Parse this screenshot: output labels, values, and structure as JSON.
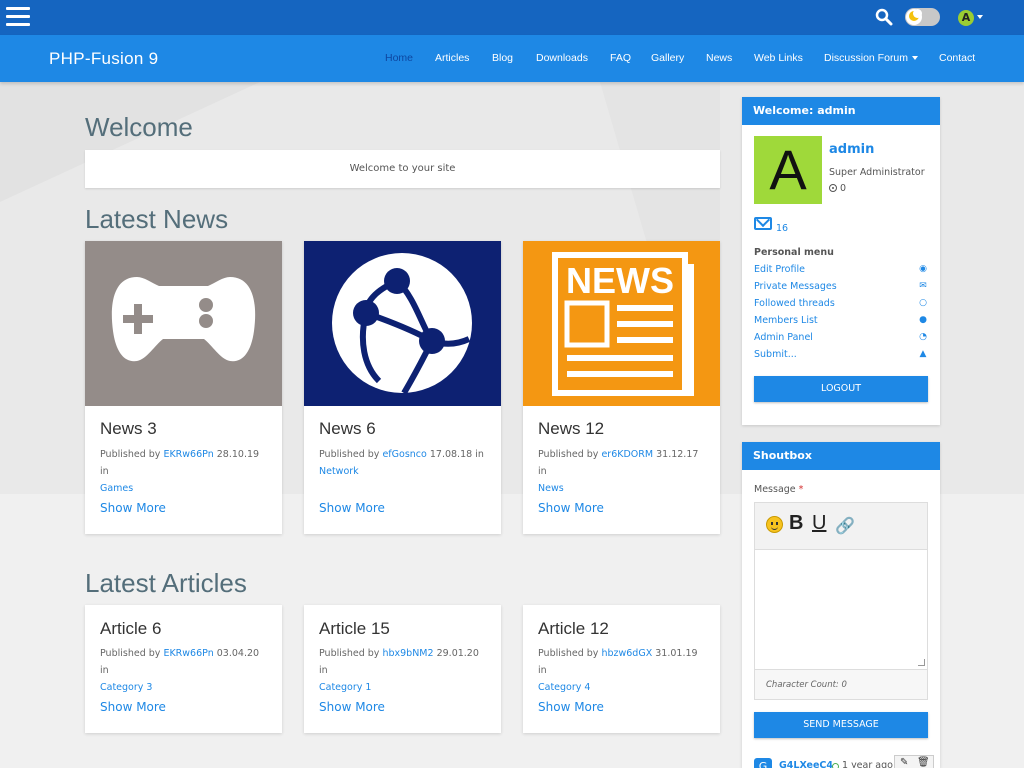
{
  "topbar": {
    "menu_icon": "hamburger-icon",
    "search_icon": "search-icon",
    "theme_icon": "moon-toggle-icon",
    "user_initial": "A"
  },
  "nav": {
    "brand": "PHP-Fusion 9",
    "items": [
      {
        "label": "Home",
        "active": true
      },
      {
        "label": "Articles"
      },
      {
        "label": "Blog"
      },
      {
        "label": "Downloads"
      },
      {
        "label": "FAQ"
      },
      {
        "label": "Gallery"
      },
      {
        "label": "News"
      },
      {
        "label": "Web Links"
      },
      {
        "label": "Discussion Forum",
        "dropdown": true
      },
      {
        "label": "Contact"
      }
    ]
  },
  "welcome": {
    "title": "Welcome",
    "message": "Welcome to your site"
  },
  "latest_news": {
    "title": "Latest News",
    "cards": [
      {
        "title": "News 3",
        "published_by": "Published by",
        "author": "EKRw66Pn",
        "date": "28.10.19",
        "in": "in",
        "category": "Games",
        "more": "Show More",
        "image_icon": "gamepad-icon",
        "image_color": "#948c89"
      },
      {
        "title": "News 6",
        "published_by": "Published by",
        "author": "efGosnco",
        "date": "17.08.18",
        "in": "in",
        "category": "Network",
        "more": "Show More",
        "image_icon": "globe-network-icon",
        "image_color": "#0d2172"
      },
      {
        "title": "News 12",
        "published_by": "Published by",
        "author": "er6KDORM",
        "date": "31.12.17",
        "in": "in",
        "category": "News",
        "more": "Show More",
        "image_icon": "newspaper-icon",
        "image_color": "#f49712"
      }
    ]
  },
  "latest_articles": {
    "title": "Latest Articles",
    "cards": [
      {
        "title": "Article 6",
        "published_by": "Published by",
        "author": "EKRw66Pn",
        "date": "03.04.20",
        "in": "in",
        "category": "Category 3",
        "more": "Show More"
      },
      {
        "title": "Article 15",
        "published_by": "Published by",
        "author": "hbx9bNM2",
        "date": "29.01.20",
        "in": "in",
        "category": "Category 1",
        "more": "Show More"
      },
      {
        "title": "Article 12",
        "published_by": "Published by",
        "author": "hbzw6dGX",
        "date": "31.01.19",
        "in": "in",
        "category": "Category 4",
        "more": "Show More"
      }
    ]
  },
  "user_panel": {
    "title": "Welcome: admin",
    "avatar_letter": "A",
    "username": "admin",
    "role": "Super Administrator",
    "reputation": "0",
    "messages_count": "16",
    "personal_menu_title": "Personal menu",
    "menu": [
      {
        "label": "Edit Profile",
        "icon": "user-circle-icon"
      },
      {
        "label": "Private Messages",
        "icon": "envelope-icon"
      },
      {
        "label": "Followed threads",
        "icon": "comment-icon"
      },
      {
        "label": "Members List",
        "icon": "users-icon"
      },
      {
        "label": "Admin Panel",
        "icon": "dashboard-icon"
      },
      {
        "label": "Submit...",
        "icon": "cloud-upload-icon"
      }
    ],
    "logout": "LOGOUT"
  },
  "shoutbox": {
    "title": "Shoutbox",
    "message_label": "Message",
    "required_mark": "*",
    "char_count": "Character Count: 0",
    "send": "SEND MESSAGE",
    "entry": {
      "avatar": "G",
      "user": "G4LXeeC4",
      "time": "1 year ago"
    }
  },
  "colors": {
    "topbar": "#1565c0",
    "navbar": "#1e88e5",
    "accent": "#1e88e5",
    "avatar": "#9fd93a"
  }
}
